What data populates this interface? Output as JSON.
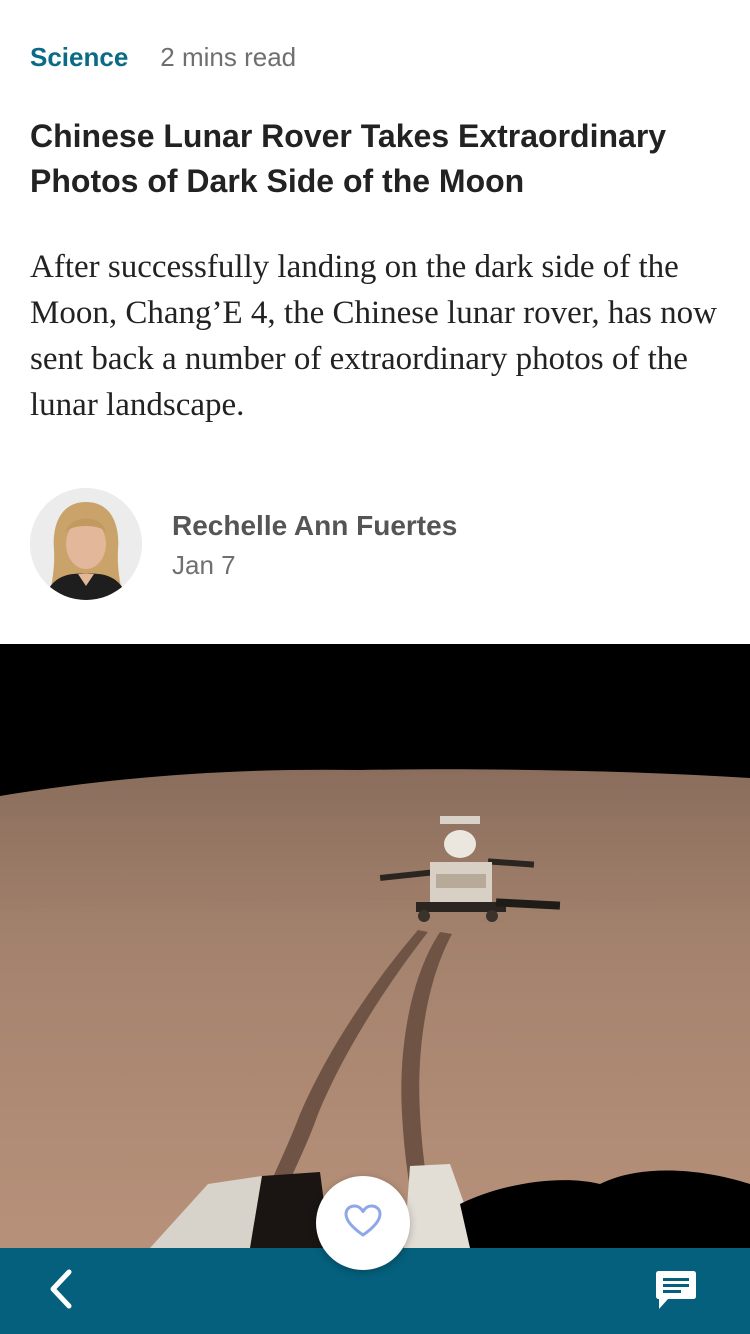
{
  "article": {
    "category": "Science",
    "read_time": "2 mins read",
    "title": "Chinese Lunar Rover Takes Extraordinary Photos of Dark Side of the Moon",
    "summary": "After successfully landing on the dark side of the Moon, Chang’E 4, the Chinese lunar rover, has now sent back a number of extraordinary photos of the lunar landscape."
  },
  "author": {
    "name": "Rechelle Ann Fuertes",
    "date": "Jan 7"
  },
  "icons": {
    "like": "heart-outline-icon",
    "back": "chevron-left-icon",
    "comments": "comment-bubble-icon"
  },
  "colors": {
    "category": "#0b6a86",
    "bottom_bar": "#05607d",
    "like_icon": "#8fa6e8"
  }
}
